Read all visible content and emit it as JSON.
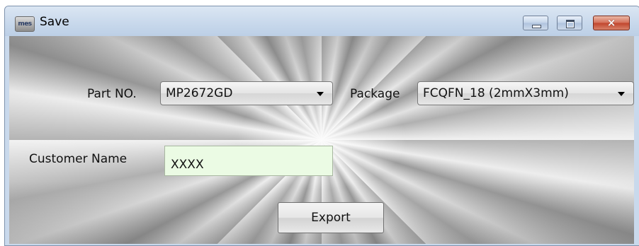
{
  "window": {
    "title": "Save",
    "app_icon_text": "mes",
    "controls": {
      "minimize": "minimize",
      "maximize": "maximize",
      "close": "×"
    }
  },
  "form": {
    "part_no": {
      "label": "Part NO.",
      "value": "MP2672GD"
    },
    "package": {
      "label": "Package",
      "value": "FCQFN_18 (2mmX3mm)"
    },
    "customer_name": {
      "label": "Customer Name",
      "value": "XXXX"
    },
    "export_label": "Export"
  },
  "colors": {
    "titlebar": "#c9d9ec",
    "close_button": "#c1462d",
    "customer_field_bg": "#ebfbe4"
  }
}
